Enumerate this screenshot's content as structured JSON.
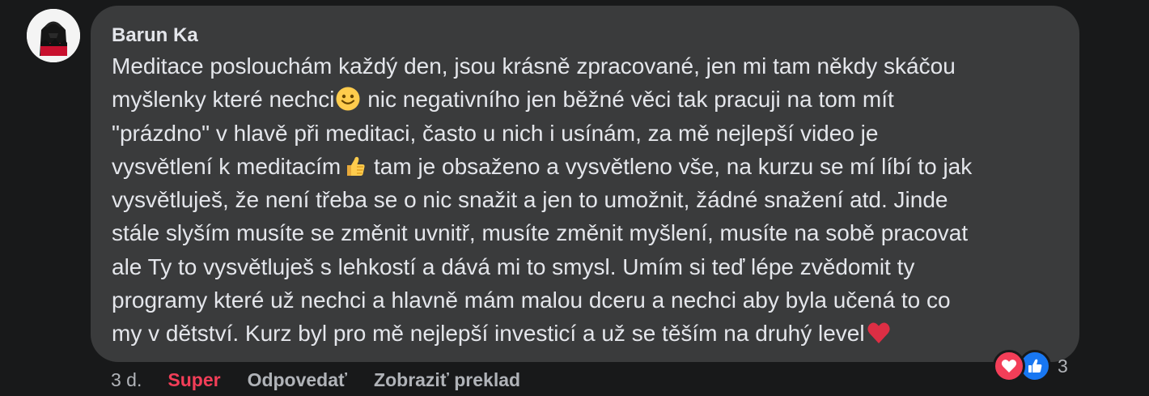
{
  "comment": {
    "author": "Barun Ka",
    "lines": [
      "Meditace poslouchám každý den, jsou krásně zpracované, jen mi tam někdy skáčou",
      "myšlenky které nechci",
      " nic negativního jen běžné věci tak pracuji na tom mít",
      "\"prázdno\" v hlavě při meditaci, často u nich i usínám, za mě nejlepší video je",
      "vysvětlení k meditacím",
      " tam je obsaženo a vysvětleno vše, na kurzu se mí líbí to jak",
      "vysvětluješ, že není třeba se o nic snažit a jen to umožnit, žádné snažení atd. Jinde",
      "stále slyším musíte se změnit uvnitř, musíte změnit myšlení, musíte na sobě pracovat",
      "ale Ty to vysvětluješ s lehkostí a dává mi to smysl. Umím si teď lépe zvědomit ty",
      "programy které už nechci a hlavně mám malou dceru a nechci aby byla učená to co",
      "my v dětství. Kurz byl pro mě nejlepší investicí a už se těším na druhý level"
    ],
    "emojis": {
      "smile": "slightly-smiling-face-icon",
      "thumbs": "thumbs-up-icon",
      "heart": "red-heart-icon"
    }
  },
  "actions": {
    "time": "3 d.",
    "reaction_label": "Super",
    "reply_label": "Odpovedať",
    "translate_label": "Zobraziť preklad"
  },
  "reactions": {
    "count": "3",
    "types": [
      "love-icon",
      "like-icon"
    ]
  },
  "colors": {
    "background": "#18191a",
    "bubble": "#3a3b3c",
    "text": "#e4e6eb",
    "secondary_text": "#b0b3b8",
    "super": "#f33e58",
    "like": "#1877f2"
  }
}
